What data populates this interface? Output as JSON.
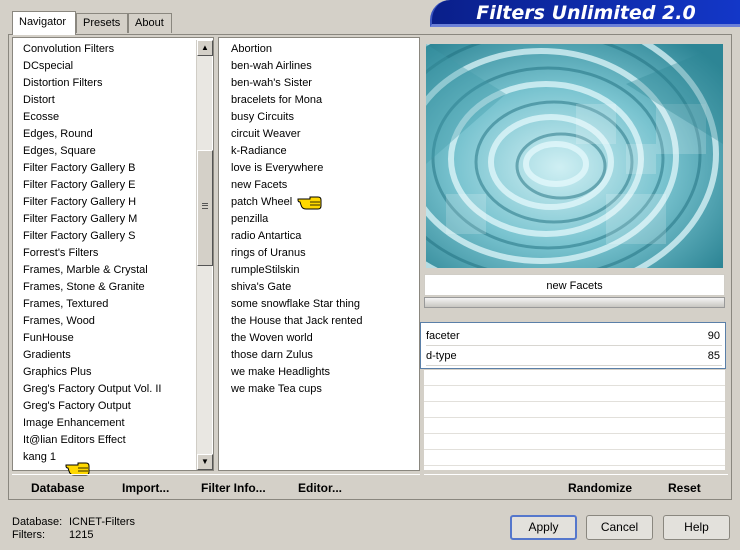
{
  "tabs": [
    "Navigator",
    "Presets",
    "About"
  ],
  "banner_title": "Filters Unlimited 2.0",
  "categories": [
    "Convolution Filters",
    "DCspecial",
    "Distortion Filters",
    "Distort",
    "Ecosse",
    "Edges, Round",
    "Edges, Square",
    "Filter Factory Gallery B",
    "Filter Factory Gallery E",
    "Filter Factory Gallery H",
    "Filter Factory Gallery M",
    "Filter Factory Gallery S",
    "Forrest's Filters",
    "Frames, Marble & Crystal",
    "Frames, Stone & Granite",
    "Frames, Textured",
    "Frames, Wood",
    "FunHouse",
    "Gradients",
    "Graphics Plus",
    "Greg's Factory Output Vol. II",
    "Greg's Factory Output",
    "Image Enhancement",
    "It@lian Editors Effect",
    "kang 1"
  ],
  "filters": [
    "Abortion",
    "ben-wah Airlines",
    "ben-wah's Sister",
    "bracelets for Mona",
    "busy Circuits",
    "circuit Weaver",
    "k-Radiance",
    "love is Everywhere",
    "new Facets",
    "patch Wheel",
    "penzilla",
    "radio Antartica",
    "rings of Uranus",
    "rumpleStilskin",
    "shiva's Gate",
    "some snowflake Star thing",
    "the House that Jack rented",
    "the Woven world",
    "those darn Zulus",
    "we make Headlights",
    "we make Tea cups"
  ],
  "left_actions": {
    "database": "Database",
    "import": "Import...",
    "filter_info": "Filter Info...",
    "editor": "Editor..."
  },
  "right_actions": {
    "randomize": "Randomize",
    "reset": "Reset"
  },
  "selected_filter": "new Facets",
  "params": [
    {
      "name": "faceter",
      "value": "90"
    },
    {
      "name": "d-type",
      "value": "85"
    }
  ],
  "status": {
    "db_label": "Database:",
    "db_value": "ICNET-Filters",
    "filters_label": "Filters:",
    "filters_value": "1215"
  },
  "buttons": {
    "apply": "Apply",
    "cancel": "Cancel",
    "help": "Help"
  },
  "icons": {
    "pointer": "pointing-hand-icon"
  }
}
